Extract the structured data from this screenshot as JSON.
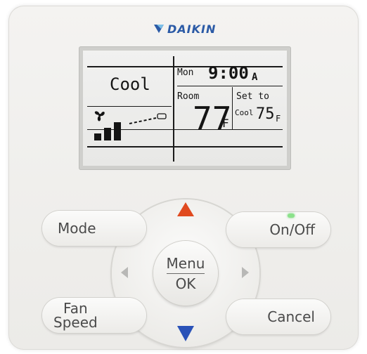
{
  "brand": {
    "name": "DAIKIN",
    "color": "#2b5aa6"
  },
  "lcd": {
    "mode": "Cool",
    "day": "Mon",
    "time": "9:00",
    "ampm": "A",
    "room_label": "Room",
    "room_temp": "77",
    "room_unit": "F",
    "setto_label": "Set to",
    "setto_mode": "Cool",
    "setpoint": "75",
    "setpoint_unit": "F"
  },
  "buttons": {
    "mode": "Mode",
    "on_off": "On/Off",
    "fan_line1": "Fan",
    "fan_line2": "Speed",
    "cancel": "Cancel",
    "menu": "Menu",
    "ok": "OK"
  },
  "colors": {
    "up_arrow": "#e04a1f",
    "down_arrow": "#2a52b8",
    "side_arrow": "#b8b8b6",
    "led": "#8be28b"
  },
  "icons": {
    "fan": "fan-icon",
    "fan_speed_bars": "fan-speed-bars-icon",
    "airflow": "airflow-direction-icon"
  }
}
